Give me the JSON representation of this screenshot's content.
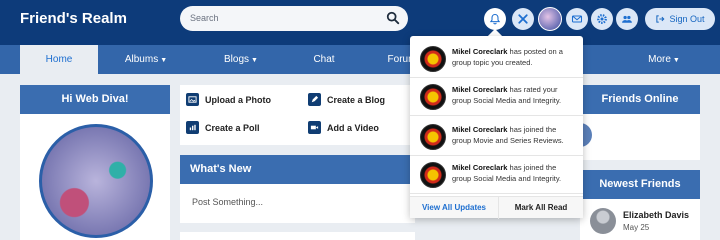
{
  "header": {
    "site_title": "Friend's Realm",
    "search_placeholder": "Search",
    "icons": [
      "bell-icon",
      "puzzle-icon",
      "avatar",
      "mail-icon",
      "gear-icon",
      "users-icon"
    ],
    "sign_out_label": "Sign Out"
  },
  "nav": {
    "items": [
      {
        "label": "Home",
        "active": true,
        "dropdown": false
      },
      {
        "label": "Albums",
        "active": false,
        "dropdown": true
      },
      {
        "label": "Blogs",
        "active": false,
        "dropdown": true
      },
      {
        "label": "Chat",
        "active": false,
        "dropdown": false
      },
      {
        "label": "Forum",
        "active": false,
        "dropdown": false
      },
      {
        "label": "More",
        "active": false,
        "dropdown": true
      }
    ]
  },
  "welcome": {
    "title": "Hi Web Diva!"
  },
  "actions": {
    "upload_photo": "Upload a Photo",
    "create_blog": "Create a Blog",
    "create_poll": "Create a Poll",
    "add_video": "Add a Video"
  },
  "whats_new": {
    "title": "What's New",
    "post_placeholder": "Post Something..."
  },
  "friends_online": {
    "title": "Friends Online"
  },
  "newest_friends": {
    "title": "Newest Friends",
    "items": [
      {
        "name": "Elizabeth Davis",
        "date": "May 25"
      }
    ]
  },
  "notifications": {
    "items": [
      {
        "user": "Mikel Coreclark",
        "text": " has posted on a group topic you created."
      },
      {
        "user": "Mikel Coreclark",
        "text": " has rated your group Social Media and Integrity."
      },
      {
        "user": "Mikel Coreclark",
        "text": " has joined the group Movie and Series Reviews."
      },
      {
        "user": "Mikel Coreclark",
        "text": " has joined the group Social Media and Integrity."
      }
    ],
    "view_all": "View All Updates",
    "mark_all_read": "Mark All Read"
  },
  "colors": {
    "header_bg": "#0d3b7a",
    "nav_bg": "#3366aa",
    "card_header": "#3a6db0",
    "accent": "#1e6fd0"
  }
}
